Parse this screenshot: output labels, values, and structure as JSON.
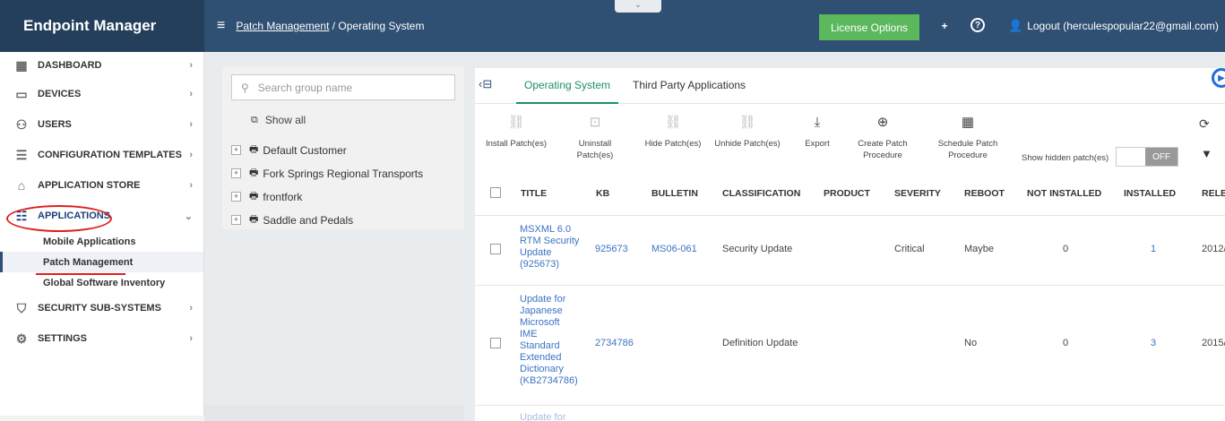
{
  "app": {
    "title": "Endpoint Manager"
  },
  "header": {
    "breadcrumb_link": "Patch Management",
    "breadcrumb_sep": " / ",
    "breadcrumb_current": "Operating System",
    "collapse_tab": "⌄",
    "license_button": "License Options",
    "logout_label": "Logout (herculespopular22@gmail.com)"
  },
  "sidebar": {
    "items": [
      {
        "label": "DASHBOARD",
        "icon": "dashboard-icon"
      },
      {
        "label": "DEVICES",
        "icon": "devices-icon"
      },
      {
        "label": "USERS",
        "icon": "users-icon"
      },
      {
        "label": "CONFIGURATION TEMPLATES",
        "icon": "templates-icon"
      },
      {
        "label": "APPLICATION STORE",
        "icon": "store-icon"
      },
      {
        "label": "APPLICATIONS",
        "icon": "applications-icon"
      },
      {
        "label": "SECURITY SUB-SYSTEMS",
        "icon": "shield-icon"
      },
      {
        "label": "SETTINGS",
        "icon": "gear-icon"
      }
    ],
    "subitems": [
      "Mobile Applications",
      "Patch Management",
      "Global Software Inventory"
    ]
  },
  "groups": {
    "search_placeholder": "Search group name",
    "show_all": "Show all",
    "items": [
      "Default Customer",
      "Fork Springs Regional Transports",
      "frontfork",
      "Saddle and Pedals"
    ]
  },
  "tabs": {
    "os": "Operating System",
    "third_party": "Third Party Applications"
  },
  "toolbar": {
    "install": "Install Patch(es)",
    "uninstall_1": "Uninstall",
    "uninstall_2": "Patch(es)",
    "hide": "Hide Patch(es)",
    "unhide": "Unhide Patch(es)",
    "export": "Export",
    "create_1": "Create Patch",
    "create_2": "Procedure",
    "schedule_1": "Schedule Patch",
    "schedule_2": "Procedure",
    "show_hidden": "Show hidden patch(es)",
    "toggle": "OFF"
  },
  "table": {
    "headers": [
      "TITLE",
      "KB",
      "BULLETIN",
      "CLASSIFICATION",
      "PRODUCT",
      "SEVERITY",
      "REBOOT",
      "NOT INSTALLED",
      "INSTALLED",
      "RELEA"
    ],
    "rows": [
      {
        "title_lines": [
          "MSXML 6.0",
          "RTM Security",
          "Update",
          "(925673)"
        ],
        "kb": "925673",
        "bulletin": "MS06-061",
        "classification": "Security Update",
        "product": "",
        "severity": "Critical",
        "reboot": "Maybe",
        "not_installed": "0",
        "installed": "1",
        "release": "2012/"
      },
      {
        "title_lines": [
          "Update for",
          "Japanese",
          "Microsoft",
          "IME",
          "Standard",
          "Extended",
          "Dictionary",
          "(KB2734786)"
        ],
        "kb": "2734786",
        "bulletin": "",
        "classification": "Definition Update",
        "product": "",
        "severity": "",
        "reboot": "No",
        "not_installed": "0",
        "installed": "3",
        "release": "2015/"
      },
      {
        "title_lines": [
          "Update for"
        ]
      }
    ]
  }
}
